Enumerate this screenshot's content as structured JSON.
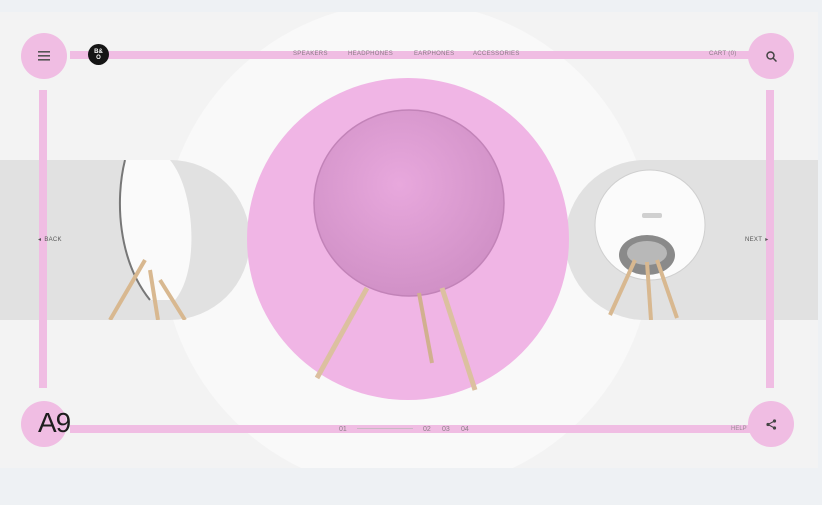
{
  "nav": {
    "items": [
      "SPEAKERS",
      "HEADPHONES",
      "EARPHONES",
      "ACCESSORIES"
    ],
    "cart": "CART (0)"
  },
  "logo": {
    "line1": "B&",
    "line2": "O"
  },
  "carousel": {
    "back_label": "BACK",
    "next_label": "NEXT",
    "model": "A9",
    "pages": {
      "current": "01",
      "others": [
        "02",
        "03",
        "04"
      ]
    },
    "help": "HELP"
  },
  "colors": {
    "accent": "#f0bde3",
    "hero": "#f0b5e5",
    "speaker_grille": "#e1a0d6",
    "leg_wood": "#dcc0a0",
    "band": "#e1e1e1"
  },
  "icons": [
    "menu-icon",
    "search-icon",
    "share-icon",
    "arrow-left-icon",
    "arrow-right-icon"
  ]
}
